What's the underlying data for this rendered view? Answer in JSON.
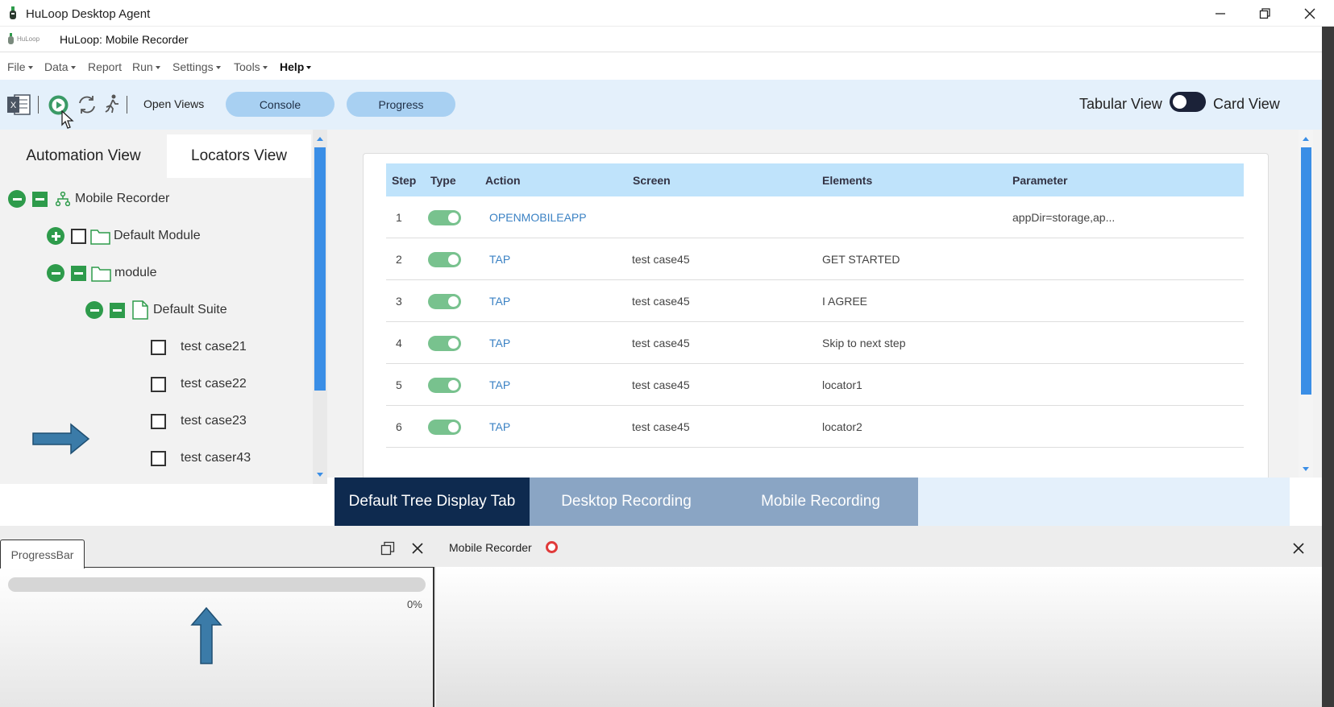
{
  "window": {
    "title": "HuLoop Desktop Agent",
    "subtitle": "HuLoop: Mobile Recorder",
    "logo_text": "HuLoop"
  },
  "menu": [
    "File",
    "Data",
    "Report",
    "Run",
    "Settings",
    "Tools",
    "Help"
  ],
  "toolbar": {
    "open_views": "Open Views",
    "console": "Console",
    "progress": "Progress",
    "tabular_view": "Tabular View",
    "card_view": "Card View",
    "icons": [
      "excel-icon",
      "play-icon",
      "refresh-icon",
      "run-person-icon"
    ],
    "toggle_state": "card-view"
  },
  "left_tabs": {
    "automation": "Automation View",
    "locators": "Locators View"
  },
  "tree": {
    "root": "Mobile Recorder",
    "default_module": "Default Module",
    "module": "module",
    "suite": "Default Suite",
    "cases": [
      "test case21",
      "test case22",
      "test case23",
      "test caser43"
    ]
  },
  "table": {
    "headers": [
      "Step",
      "Type",
      "Action",
      "Screen",
      "Elements",
      "Parameter"
    ],
    "rows": [
      {
        "step": "1",
        "action": "OPENMOBILEAPP",
        "screen": "",
        "elements": "",
        "parameter": "appDir=storage,ap..."
      },
      {
        "step": "2",
        "action": "TAP",
        "screen": "test case45",
        "elements": "GET STARTED",
        "parameter": ""
      },
      {
        "step": "3",
        "action": "TAP",
        "screen": "test case45",
        "elements": "I AGREE",
        "parameter": ""
      },
      {
        "step": "4",
        "action": "TAP",
        "screen": "test case45",
        "elements": "Skip to next step",
        "parameter": ""
      },
      {
        "step": "5",
        "action": "TAP",
        "screen": "test case45",
        "elements": "locator1",
        "parameter": ""
      },
      {
        "step": "6",
        "action": "TAP",
        "screen": "test case45",
        "elements": "locator2",
        "parameter": ""
      }
    ]
  },
  "bottom_tabs": [
    "Default Tree Display Tab",
    "Desktop Recording",
    "Mobile Recording"
  ],
  "progress_panel": {
    "tab": "ProgressBar",
    "percent_label": "0%",
    "progress": 0
  },
  "recorder_panel": {
    "title": "Mobile Recorder"
  },
  "colors": {
    "accent": "#3a8ee6",
    "green": "#2e9b4b",
    "active_tab": "#0e2a4f",
    "inactive_tab": "#8aa5c4",
    "pill": "#a8d0f2",
    "header": "#bfe3fb",
    "arrow": "#3b7ba8"
  }
}
